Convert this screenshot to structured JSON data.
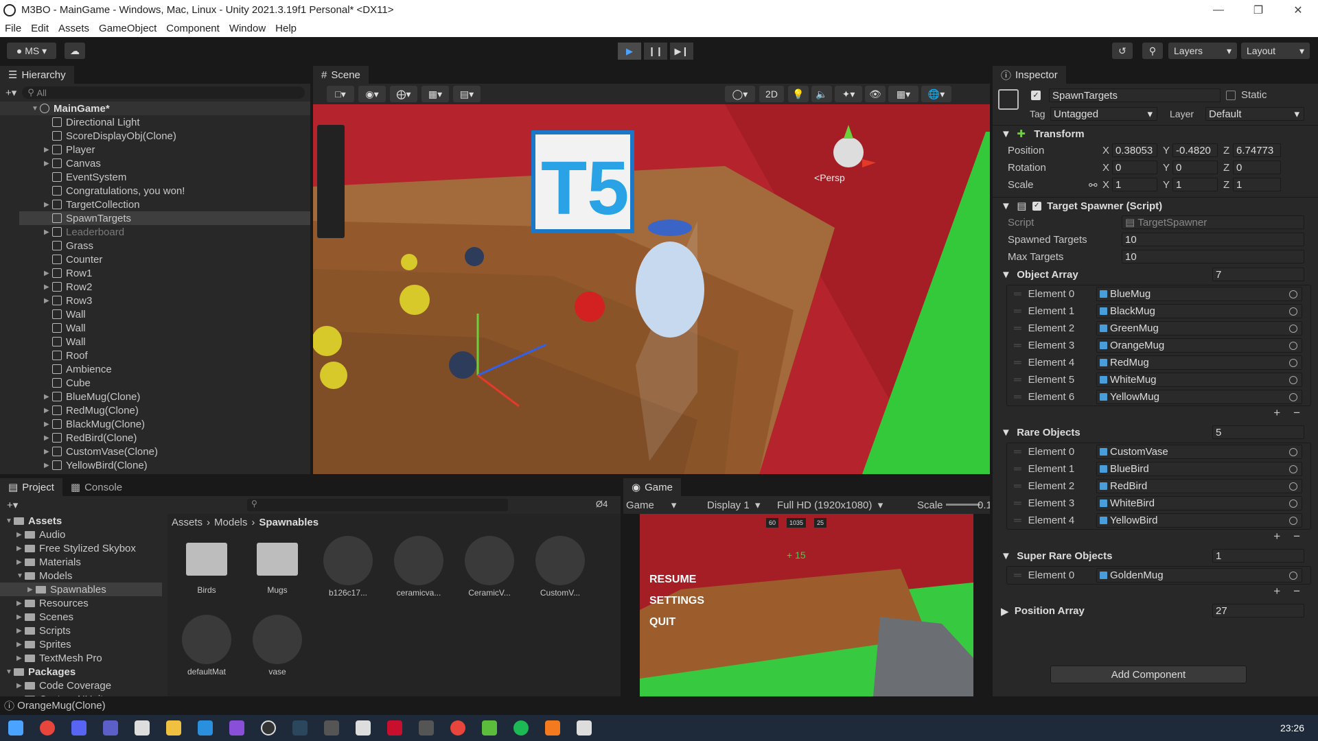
{
  "window": {
    "title": "M3BO - MainGame - Windows, Mac, Linux - Unity 2021.3.19f1 Personal* <DX11>"
  },
  "menu": [
    "File",
    "Edit",
    "Assets",
    "GameObject",
    "Component",
    "Window",
    "Help"
  ],
  "toolbar": {
    "account": "MS",
    "layers": "Layers",
    "layout": "Layout"
  },
  "hierarchy": {
    "tab": "Hierarchy",
    "search_placeholder": "All",
    "scene": "MainGame*",
    "items": [
      "Directional Light",
      "ScoreDisplayObj(Clone)",
      "Player",
      "Canvas",
      "EventSystem",
      "Congratulations, you won!",
      "TargetCollection",
      "SpawnTargets",
      "Leaderboard",
      "Grass",
      "Counter",
      "Row1",
      "Row2",
      "Row3",
      "Wall",
      "Wall",
      "Wall",
      "Roof",
      "Ambience",
      "Cube",
      "BlueMug(Clone)",
      "RedMug(Clone)",
      "BlackMug(Clone)",
      "RedBird(Clone)",
      "CustomVase(Clone)",
      "YellowBird(Clone)",
      "OrangeMug(Clone)"
    ]
  },
  "scene": {
    "tab": "Scene",
    "btn2d": "2D",
    "persp": "Persp",
    "score_text": "+15"
  },
  "game": {
    "tab": "Game",
    "mode": "Game",
    "display": "Display 1",
    "resolution": "Full HD (1920x1080)",
    "scale_label": "Scale",
    "scale_value": "0.1",
    "menu": [
      "RESUME",
      "SETTINGS",
      "QUIT"
    ],
    "popup": "+ 15",
    "hud": [
      "60",
      "1035",
      "25"
    ]
  },
  "project": {
    "tab": "Project",
    "console_tab": "Console",
    "breadcrumb": [
      "Assets",
      "Models",
      "Spawnables"
    ],
    "hidden_count": "4",
    "tree": [
      "Assets",
      "Audio",
      "Free Stylized Skybox",
      "Materials",
      "Models",
      "Spawnables",
      "Resources",
      "Scenes",
      "Scripts",
      "Sprites",
      "TextMesh Pro",
      "Packages",
      "Code Coverage",
      "Custom NUnit"
    ],
    "assets": [
      "Birds",
      "Mugs",
      "b126c17...",
      "ceramicva...",
      "CeramicV...",
      "CustomV...",
      "defaultMat",
      "vase"
    ]
  },
  "inspector": {
    "tab": "Inspector",
    "name": "SpawnTargets",
    "static": "Static",
    "tag_label": "Tag",
    "tag": "Untagged",
    "layer_label": "Layer",
    "layer": "Default",
    "transform": {
      "title": "Transform",
      "position_label": "Position",
      "rotation_label": "Rotation",
      "scale_label": "Scale",
      "pos": [
        "0.38053",
        "-0.4820",
        "6.74773"
      ],
      "rot": [
        "0",
        "0",
        "0"
      ],
      "scl": [
        "1",
        "1",
        "1"
      ]
    },
    "script": {
      "title": "Target Spawner (Script)",
      "script_label": "Script",
      "script": "TargetSpawner",
      "spawned_label": "Spawned Targets",
      "spawned": "10",
      "max_label": "Max Targets",
      "max": "10"
    },
    "object_array": {
      "title": "Object Array",
      "count": "7",
      "items": [
        "BlueMug",
        "BlackMug",
        "GreenMug",
        "OrangeMug",
        "RedMug",
        "WhiteMug",
        "YellowMug"
      ]
    },
    "rare": {
      "title": "Rare Objects",
      "count": "5",
      "items": [
        "CustomVase",
        "BlueBird",
        "RedBird",
        "WhiteBird",
        "YellowBird"
      ]
    },
    "super_rare": {
      "title": "Super Rare Objects",
      "count": "1",
      "items": [
        "GoldenMug"
      ]
    },
    "position_array": {
      "title": "Position Array",
      "count": "27"
    },
    "add_component": "Add Component"
  },
  "status": {
    "text": "OrangeMug(Clone)"
  },
  "clock": "23:26"
}
